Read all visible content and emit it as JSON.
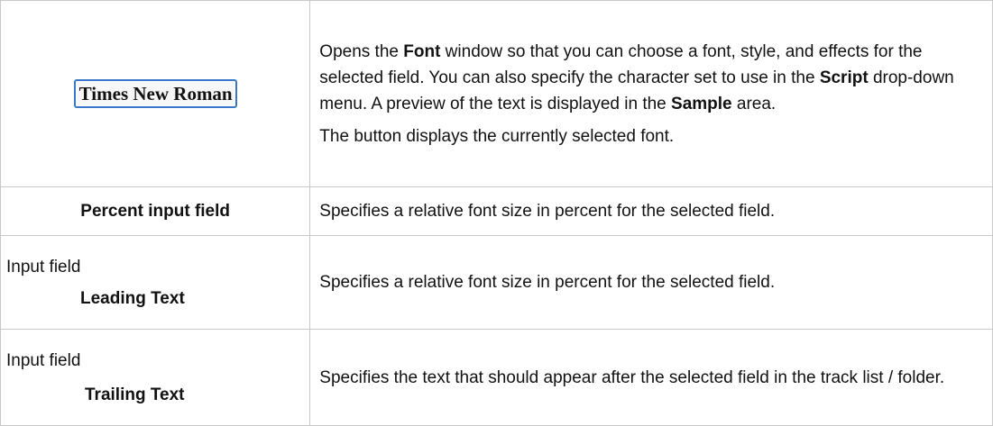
{
  "rows": [
    {
      "control": {
        "font_button_label": "Times New Roman"
      },
      "description": {
        "p1": {
          "t1": "Opens the ",
          "b1": "Font",
          "t2": " window so that you can choose a font, style, and effects for the selected field. You can also specify the character set to use in the ",
          "b2": "Script",
          "t3": " drop-down menu. A preview of the text is displayed in the ",
          "b3": "Sample",
          "t4": " area."
        },
        "p2": "The button displays the currently selected font."
      }
    },
    {
      "control": {
        "label": "Percent input field"
      },
      "description": "Specifies a relative font size in percent for the selected field."
    },
    {
      "control": {
        "plain": "Input field",
        "bold": "Leading Text"
      },
      "description": "Specifies a relative font size in percent for the selected field."
    },
    {
      "control": {
        "plain": "Input field",
        "bold": "Trailing Text"
      },
      "description": "Specifies the text that should appear after the selected field in the track list / folder."
    }
  ]
}
